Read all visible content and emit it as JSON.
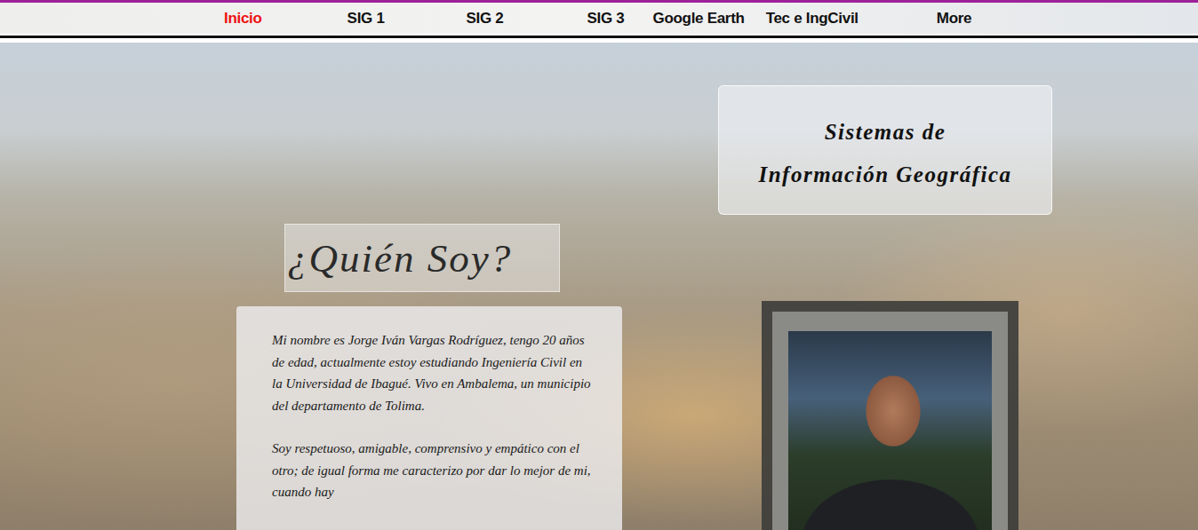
{
  "nav": {
    "items": [
      {
        "label": "Inicio",
        "selected": true
      },
      {
        "label": "SIG 1",
        "selected": false
      },
      {
        "label": "SIG 2",
        "selected": false
      },
      {
        "label": "SIG 3",
        "selected": false
      },
      {
        "label": "Google Earth",
        "selected": false
      },
      {
        "label": "Tec e IngCivil",
        "selected": false
      },
      {
        "label": "More",
        "selected": false
      }
    ]
  },
  "title_card": {
    "lines": [
      "Sistemas de",
      "Información Geográfica"
    ]
  },
  "heading": "¿Quién Soy?",
  "bio": {
    "paragraphs": [
      "Mi nombre es Jorge Iván Vargas Rodríguez, tengo 20 años de edad, actualmente estoy estudiando Ingeniería Civil en la Universidad de Ibagué. Vivo en Ambalema, un municipio del departamento de Tolima.",
      "Soy respetuoso, amigable, comprensivo y empático con el otro; de igual forma me caracterizo por dar lo mejor de mi, cuando hay"
    ]
  }
}
